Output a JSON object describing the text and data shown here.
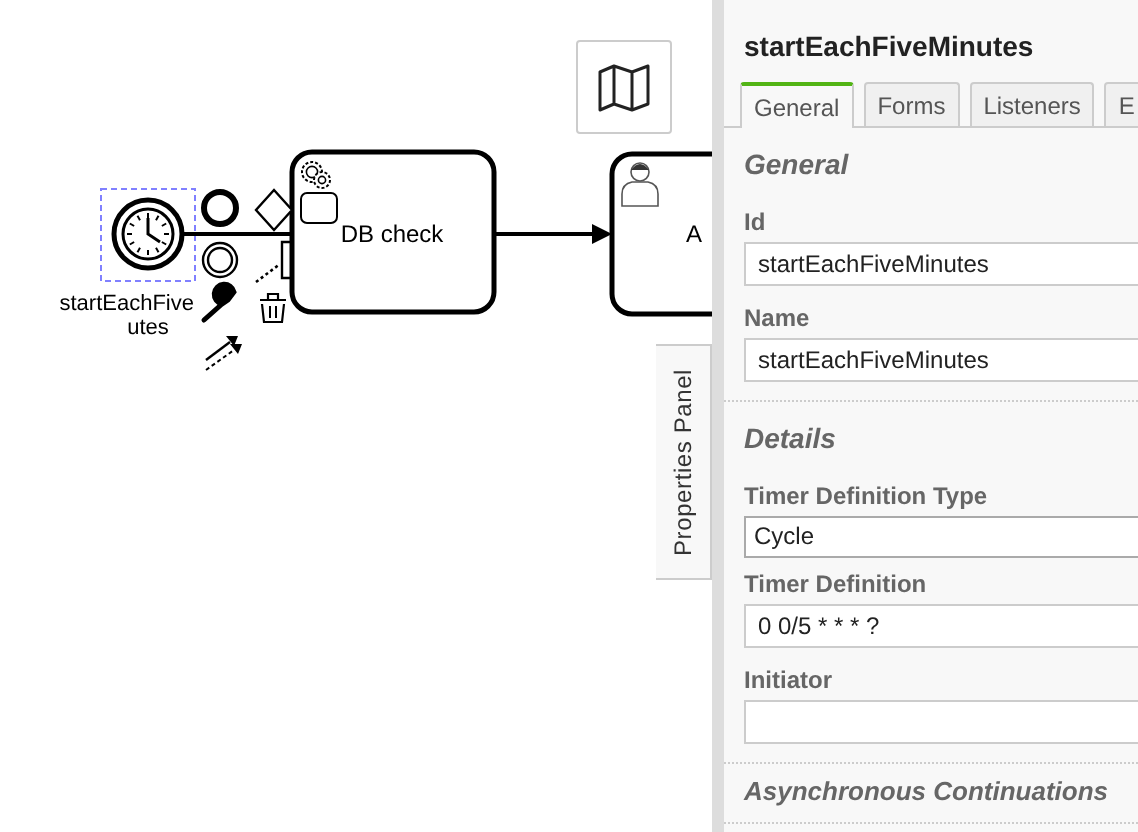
{
  "canvas": {
    "start_event": {
      "selected": true,
      "label_lines": [
        "startEachFive",
        "utes"
      ]
    },
    "tasks": [
      {
        "kind": "service",
        "name": "DB check"
      },
      {
        "kind": "user",
        "name": "A"
      }
    ]
  },
  "properties_panel": {
    "toggle_label": "Properties Panel",
    "title": "startEachFiveMinutes",
    "tabs": [
      {
        "label": "General",
        "selected": true
      },
      {
        "label": "Forms",
        "selected": false
      },
      {
        "label": "Listeners",
        "selected": false
      },
      {
        "label": "E",
        "selected": false
      }
    ],
    "sections": [
      {
        "heading": "General",
        "fields": [
          {
            "kind": "text",
            "label": "Id",
            "value": "startEachFiveMinutes"
          },
          {
            "kind": "text",
            "label": "Name",
            "value": "startEachFiveMinutes"
          }
        ]
      },
      {
        "heading": "Details",
        "fields": [
          {
            "kind": "select",
            "label": "Timer Definition Type",
            "value": "Cycle"
          },
          {
            "kind": "text",
            "label": "Timer Definition",
            "value": "0 0/5 * * * ?"
          },
          {
            "kind": "text",
            "label": "Initiator"
          }
        ]
      },
      {
        "heading": "Asynchronous Continuations"
      }
    ]
  }
}
